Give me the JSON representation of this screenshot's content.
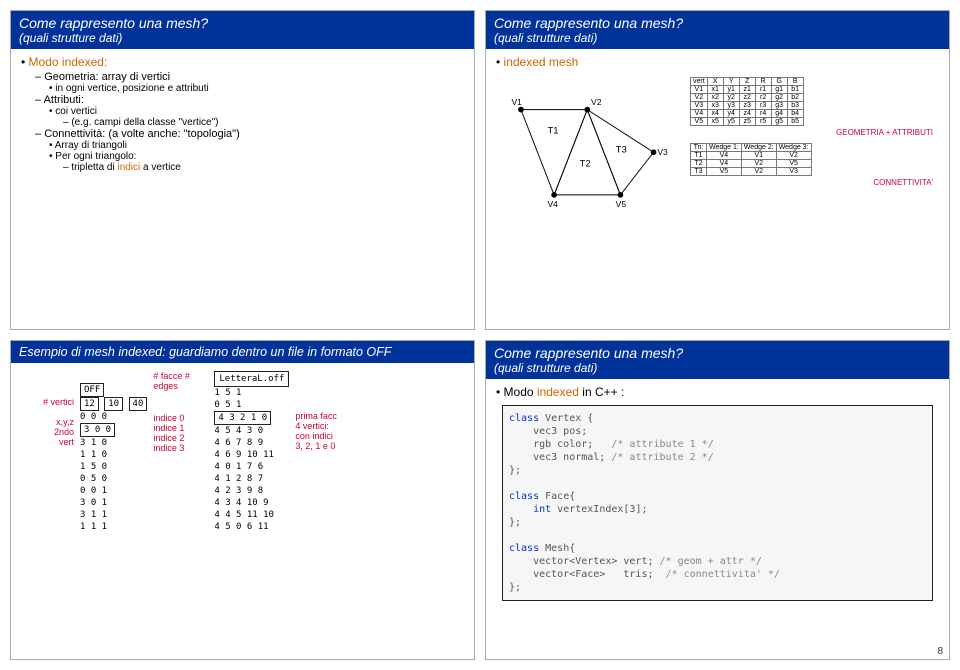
{
  "pagenum": "8",
  "header": {
    "title": "Come rappresento una mesh?",
    "subtitle": "(quali strutture dati)"
  },
  "slide1": {
    "b1": "Modo indexed:",
    "geom": "Geometria:",
    "geom_rest": " array di vertici",
    "geom_sub1": "in ogni vertice, posizione e attributi",
    "attr": "Attributi:",
    "attr_sub1": "coi vertici",
    "attr_sub2": "(e.g. campi della classe \"vertice\")",
    "conn": "Connettività:",
    "conn_rest": " (a volte anche: \"topologia\")",
    "conn_sub1": "Array di triangoli",
    "conn_sub2": "Per ogni triangolo:",
    "conn_sub3": "tripletta di indici a vertice"
  },
  "slide2": {
    "b1": "indexed mesh",
    "vertexTable": {
      "headers": [
        "vert",
        "X",
        "Y",
        "Z",
        "R",
        "G",
        "B"
      ],
      "rows": [
        [
          "V1",
          "x1",
          "y1",
          "z1",
          "r1",
          "g1",
          "b1"
        ],
        [
          "V2",
          "x2",
          "y2",
          "z2",
          "r2",
          "g2",
          "b2"
        ],
        [
          "V3",
          "x3",
          "y3",
          "z3",
          "r3",
          "g3",
          "b3"
        ],
        [
          "V4",
          "x4",
          "y4",
          "z4",
          "r4",
          "g4",
          "b4"
        ],
        [
          "V5",
          "x5",
          "y5",
          "z5",
          "r5",
          "g5",
          "b5"
        ]
      ]
    },
    "triTable": {
      "headers": [
        "Tri:",
        "Wedge 1:",
        "Wedge 2:",
        "Wedge 3:"
      ],
      "rows": [
        [
          "T1",
          "V4",
          "V1",
          "V2"
        ],
        [
          "T2",
          "V4",
          "V2",
          "V5"
        ],
        [
          "T3",
          "V5",
          "V2",
          "V3"
        ]
      ]
    },
    "geomLabel": "GEOMETRIA + ATTRIBUTI",
    "connLabel": "CONNETTIVITA'",
    "verts": {
      "V1": "V1",
      "V2": "V2",
      "V3": "V3",
      "V4": "V4",
      "V5": "V5"
    },
    "tris": {
      "T1": "T1",
      "T2": "T2",
      "T3": "T3"
    }
  },
  "slide3": {
    "title": "Esempio di mesh indexed: guardiamo dentro un file in formato OFF",
    "fileLabel": "LetteraL.off",
    "nFacceLabel": "# facce",
    "nEdgesLabel": "# edges",
    "nVerticiLabel": "# vertici",
    "xyzLabel": "x,y,z\n2ndo\nvert",
    "indice0": "indice 0",
    "indice1": "indice 1",
    "indice2": "indice 2",
    "indice3": "indice 3",
    "primaFacc": "prima facc",
    "4vertici": "4 vertici:",
    "conIndici": "con indici",
    "3210": "3, 2, 1 e 0",
    "offHead": "OFF",
    "offCounts": [
      "12",
      "10",
      "40"
    ],
    "vertsCol": [
      "0 0 0",
      "3 0 0",
      "3 1 0",
      "1 1 0",
      "1 5 0",
      "0 5 0",
      "0 0 1",
      "3 0 1",
      "3 1 1",
      "1 1 1"
    ],
    "facesCol": [
      "1 5 1",
      "0 5 1",
      "4 3 2 1 0",
      "4 5 4 3 0",
      "4 6 7 8 9",
      "4 6 9 10 11",
      "4 0 1 7 6",
      "4 1 2 8 7",
      "4 2 3 9 8",
      "4 3 4 10 9",
      "4 4 5 11 10",
      "4 5 0 6 11"
    ]
  },
  "slide4": {
    "b1": "Modo indexed in C++ :",
    "code": {
      "l1": "class Vertex {",
      "l2": "    vec3 pos;",
      "l3": "    rgb color;   /* attribute 1 */",
      "l4": "    vec3 normal; /* attribute 2 */",
      "l5": "};",
      "l6": "",
      "l7": "class Face{",
      "l8": "    int vertexIndex[3];",
      "l9": "};",
      "l10": "",
      "l11": "class Mesh{",
      "l12": "    vector<Vertex> vert; /* geom + attr */",
      "l13": "    vector<Face>   tris;  /* connettivita' */",
      "l14": "};"
    }
  }
}
